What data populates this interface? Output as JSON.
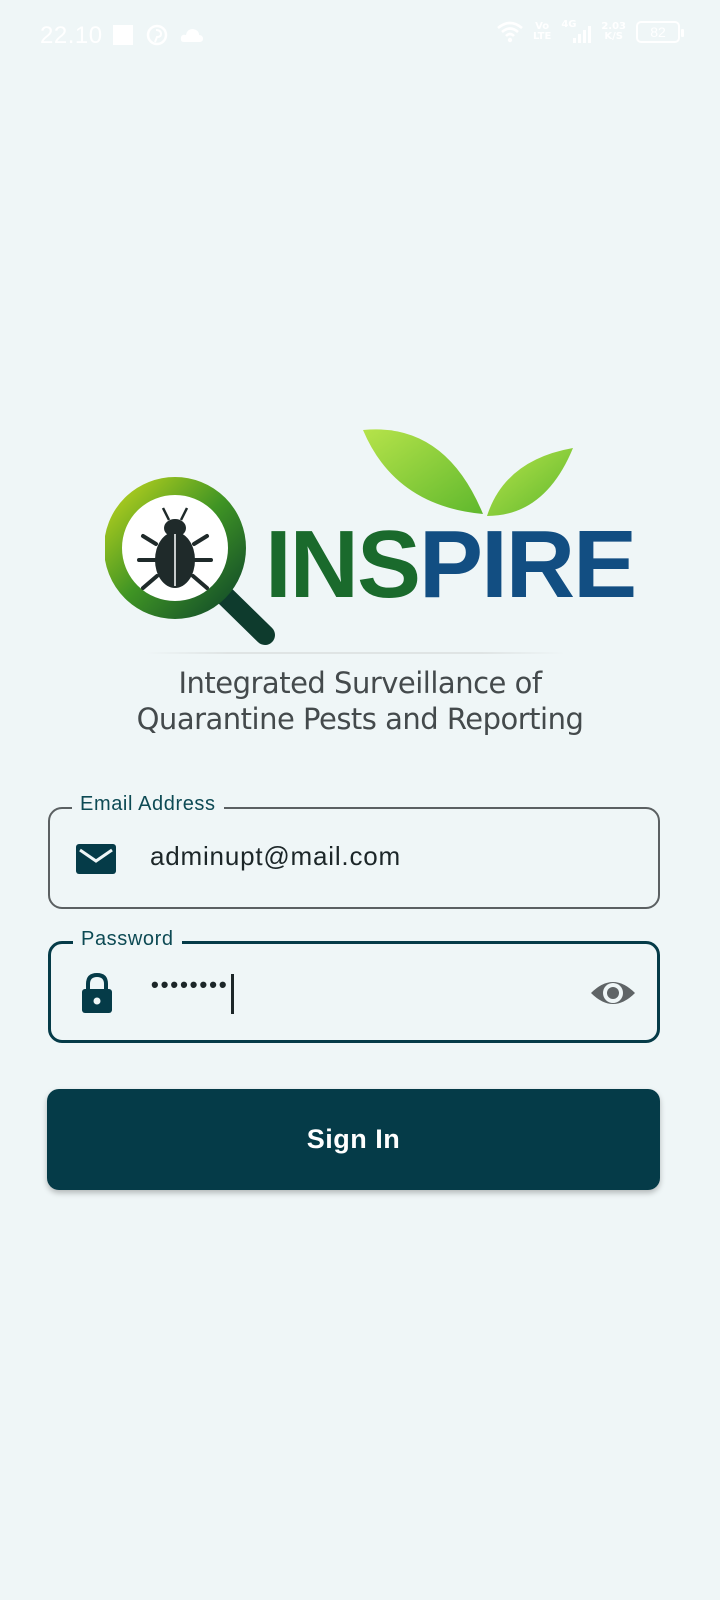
{
  "status_bar": {
    "time": "22.10",
    "network_top": "Vo",
    "network_bottom": "LTE",
    "signal_label": "4G",
    "speed_top": "2.03",
    "speed_bottom": "K/S",
    "battery_level": "82"
  },
  "logo": {
    "word_part1": "INS",
    "word_part2": "PIRE",
    "tagline_line1": "Integrated Surveillance of",
    "tagline_line2": "Quarantine  Pests and Reporting",
    "colors": {
      "green": "#1a6a2c",
      "blue": "#124e82",
      "leaf": "#8fd43a"
    }
  },
  "form": {
    "email": {
      "label": "Email Address",
      "value": "adminupt@mail.com",
      "icon": "mail-icon"
    },
    "password": {
      "label": "Password",
      "masked_value": "••••••••",
      "icon": "lock-icon",
      "toggle_icon": "eye-icon"
    },
    "submit_label": "Sign In"
  },
  "colors": {
    "primary": "#053b48",
    "background": "#eff6f7"
  }
}
